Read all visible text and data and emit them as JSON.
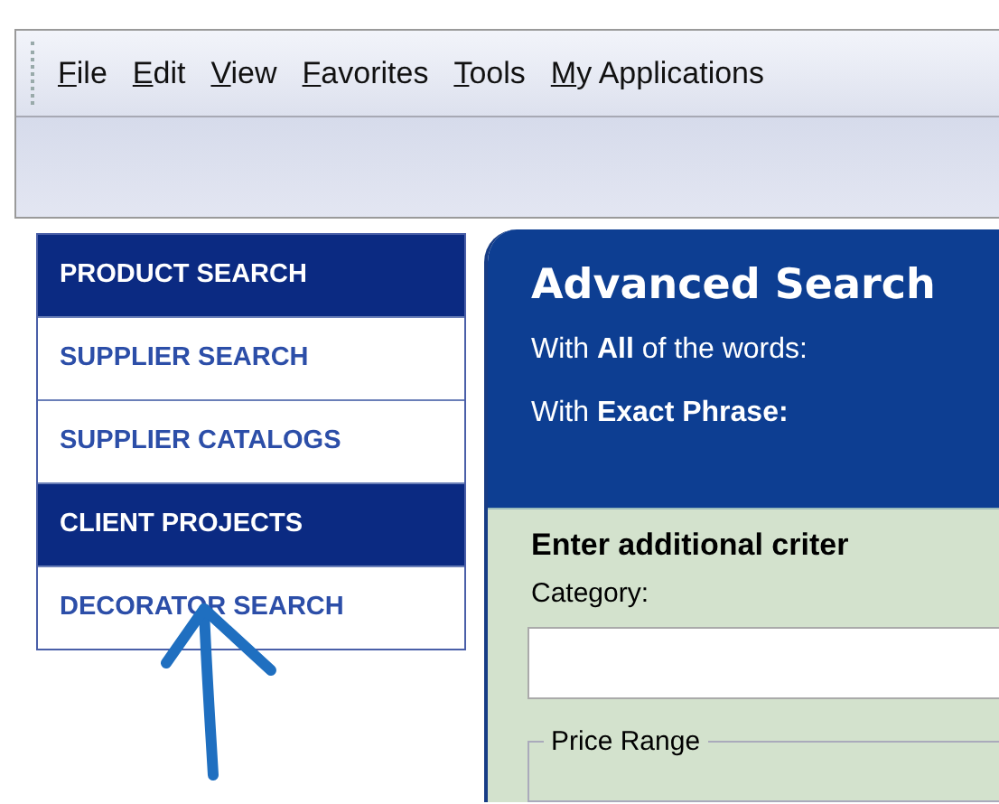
{
  "menu_bar": {
    "items": [
      {
        "label": "File"
      },
      {
        "label": "Edit"
      },
      {
        "label": "View"
      },
      {
        "label": "Favorites"
      },
      {
        "label": "Tools"
      },
      {
        "label": "My Applications"
      }
    ]
  },
  "sidebar": {
    "items": [
      {
        "label": "PRODUCT SEARCH",
        "selected": true
      },
      {
        "label": "SUPPLIER SEARCH",
        "selected": false
      },
      {
        "label": "SUPPLIER CATALOGS",
        "selected": false
      },
      {
        "label": "CLIENT PROJECTS",
        "selected": true
      },
      {
        "label": "DECORATOR SEARCH",
        "selected": false
      }
    ]
  },
  "search_panel": {
    "title": "Advanced Search",
    "lines": [
      "With **All** of the words:",
      "With **Exact Phrase:**"
    ],
    "criteria_heading": "Enter additional criter",
    "category_label": "Category:",
    "price_range_legend": "Price Range"
  }
}
